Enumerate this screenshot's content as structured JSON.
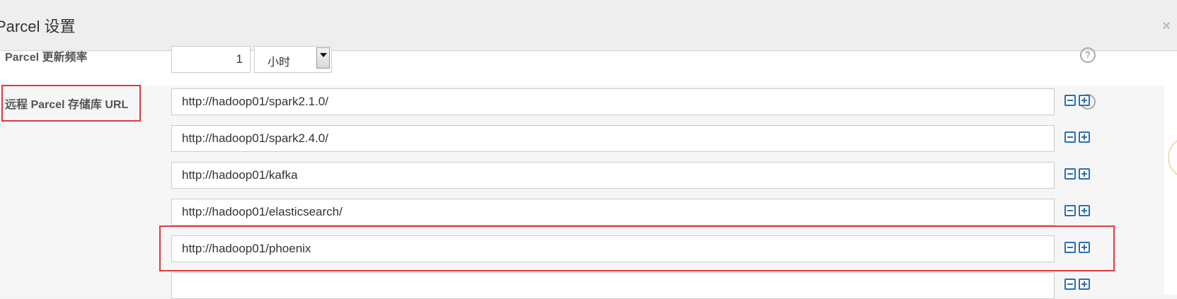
{
  "modal": {
    "title": "Parcel 设置",
    "close_label": "×"
  },
  "frequency": {
    "label": "Parcel 更新频率",
    "value": "1",
    "unit": "小时",
    "help": "?"
  },
  "repo": {
    "label": "远程 Parcel 存储库 URL",
    "help": "?",
    "urls": [
      "http://hadoop01/spark2.1.0/",
      "http://hadoop01/spark2.4.0/",
      "http://hadoop01/kafka",
      "http://hadoop01/elasticsearch/",
      "http://hadoop01/phoenix",
      ""
    ]
  },
  "colors": {
    "accent": "#2a6fb0",
    "highlight": "#e0393e"
  }
}
